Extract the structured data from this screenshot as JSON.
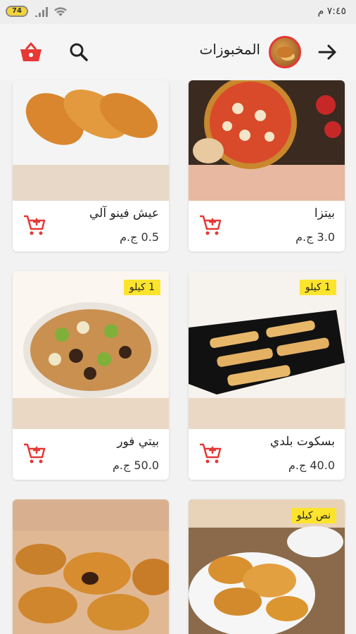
{
  "status_bar": {
    "time": "٧:٤٥ م",
    "battery": "74"
  },
  "header": {
    "title": "المخبوزات",
    "avatar": "bakery-avatar"
  },
  "colors": {
    "accent": "#e53935",
    "badge": "#fde42c"
  },
  "products": [
    {
      "name": "بيتزا",
      "price": "3.0 ج.م",
      "badge": ""
    },
    {
      "name": "عيش فينو آلي",
      "price": "0.5 ج.م",
      "badge": ""
    },
    {
      "name": "بسكوت بلدي",
      "price": "40.0 ج.م",
      "badge": "1 كيلو"
    },
    {
      "name": "بيتي فور",
      "price": "50.0 ج.م",
      "badge": "1 كيلو"
    },
    {
      "name": "",
      "price": "",
      "badge": "نص كيلو"
    },
    {
      "name": "",
      "price": "",
      "badge": ""
    }
  ]
}
